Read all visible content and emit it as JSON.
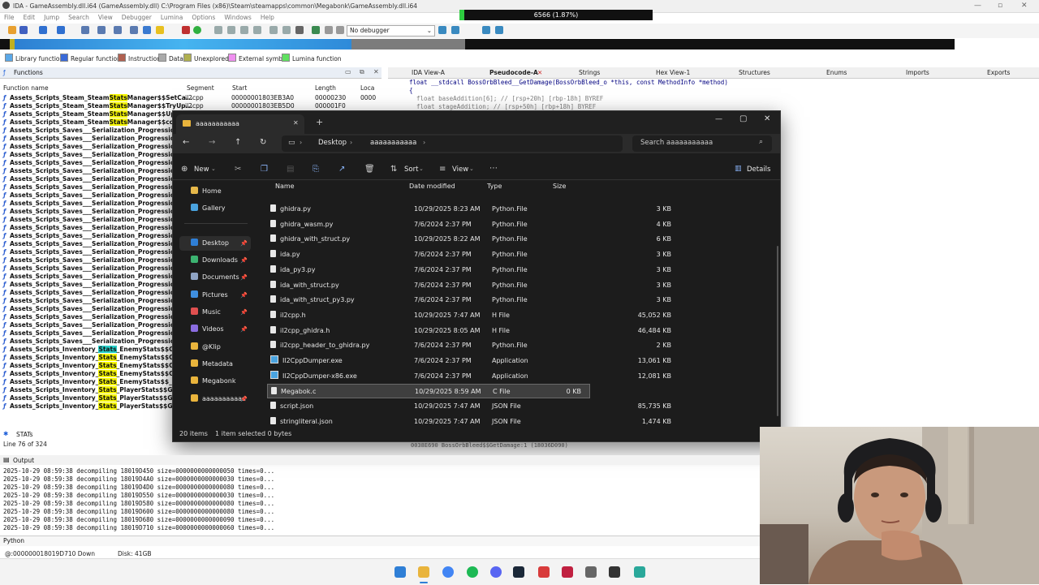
{
  "ida": {
    "title": "IDA - GameAssembly.dll.i64 (GameAssembly.dll) C:\\Program Files (x86)\\Steam\\steamapps\\common\\Megabonk\\GameAssembly.dll.i64",
    "progress_text": "6566 (1.87%)",
    "menu": [
      "File",
      "Edit",
      "Jump",
      "Search",
      "View",
      "Debugger",
      "Lumina",
      "Options",
      "Windows",
      "Help"
    ],
    "debugger_select": "No debugger",
    "legend": [
      "Library function",
      "Regular function",
      "Instruction",
      "Data",
      "Unexplored",
      "External symbol",
      "Lumina function"
    ],
    "functions_title": "Functions",
    "function_columns": [
      "Function name",
      "Segment",
      "Start",
      "Length",
      "Loca"
    ],
    "function_rows_top": [
      {
        "pre": "Assets_Scripts_Steam_Steam",
        "hl": "Stats",
        "post": "Manager$$SetCa...",
        "seg": "il2cpp",
        "start": "00000001803EB3A0",
        "len": "00000230",
        "loc": "0000"
      },
      {
        "pre": "Assets_Scripts_Steam_Steam",
        "hl": "Stats",
        "post": "Manager$$TryUp...",
        "seg": "il2cpp",
        "start": "00000001803EB5D0",
        "len": "000001F0",
        "loc": ""
      },
      {
        "pre": "Assets_Scripts_Steam_Steam",
        "hl": "Stats",
        "post": "Manager$$Upd",
        "seg": "",
        "start": "",
        "len": "",
        "loc": ""
      },
      {
        "pre": "Assets_Scripts_Steam_Steam",
        "hl": "Stats",
        "post": "Manager$$cct",
        "seg": "",
        "start": "",
        "len": "",
        "loc": ""
      }
    ],
    "progression_row": "Assets_Scripts_Saves___Serialization_Progression",
    "progression_count": 27,
    "inventory_rows": [
      {
        "pre": "Assets_Scripts_Inventory_",
        "hl": "Stats",
        "post": "_EnemyStats$$Ge",
        "cyan": true
      },
      {
        "pre": "Assets_Scripts_Inventory_",
        "hl": "Stats",
        "post": "_EnemyStats$$Ge",
        "cyan": false
      },
      {
        "pre": "Assets_Scripts_Inventory_",
        "hl": "Stats",
        "post": "_EnemyStats$$Ge",
        "cyan": false
      },
      {
        "pre": "Assets_Scripts_Inventory_",
        "hl": "Stats",
        "post": "_EnemyStats$$Ge",
        "cyan": false
      },
      {
        "pre": "Assets_Scripts_Inventory_",
        "hl": "Stats",
        "post": "_EnemyStats$$_cc",
        "cyan": false
      },
      {
        "pre": "Assets_Scripts_Inventory_",
        "hl": "Stats",
        "post": "_PlayerStats$$Ge",
        "cyan": false
      },
      {
        "pre": "Assets_Scripts_Inventory_",
        "hl": "Stats",
        "post": "_PlayerStats$$Ge",
        "cyan": false
      },
      {
        "pre": "Assets_Scripts_Inventory_",
        "hl": "Stats",
        "post": "_PlayerStats$$Ge",
        "cyan": false
      }
    ],
    "ps_tabs": [
      "IDA View-A",
      "Pseudocode-A",
      "Strings",
      "Hex View-1",
      "Structures",
      "Enums",
      "Imports",
      "Exports"
    ],
    "code_lines": [
      "float __stdcall BossOrbBleed__GetDamage(BossOrbBleed_o *this, const MethodInfo *method)",
      "{",
      "  float baseAddition[6]; // [rsp+20h] [rbp-18h] BYREF",
      "  float stageAddition; // [rsp+50h] [rbp+18h] BYREF"
    ],
    "code_status": "0038E690 BossOrbBleed$$GetDamage:1 (18036D090)",
    "stats_tab": "STATs",
    "line_info": "Line 76 of 324",
    "output_title": "Output",
    "output_lines": [
      "2025-10-29 08:59:38 decompiling 18019D450 size=0000000000000050 times=0...",
      "2025-10-29 08:59:38 decompiling 18019D4A0 size=0000000000000030 times=0...",
      "2025-10-29 08:59:38 decompiling 18019D4D0 size=0000000000000080 times=0...",
      "2025-10-29 08:59:38 decompiling 18019D550 size=0000000000000030 times=0...",
      "2025-10-29 08:59:38 decompiling 18019D580 size=0000000000000080 times=0...",
      "2025-10-29 08:59:38 decompiling 18019D600 size=0000000000000080 times=0...",
      "2025-10-29 08:59:38 decompiling 18019D680 size=0000000000000090 times=0...",
      "2025-10-29 08:59:38 decompiling 18019D710 size=0000000000000060 times=0..."
    ],
    "python_label": "Python",
    "status_left": "@:000000018019D710  Down",
    "status_disk": "Disk: 41GB"
  },
  "explorer": {
    "tab_title": "aaaaaaaaaaa",
    "breadcrumb": [
      "Desktop",
      "aaaaaaaaaaa"
    ],
    "search_placeholder": "Search aaaaaaaaaaa",
    "cmd": {
      "new": "New",
      "sort": "Sort",
      "view": "View",
      "details": "Details"
    },
    "nav": [
      {
        "label": "Home",
        "color": "#e6b84a"
      },
      {
        "label": "Gallery",
        "color": "#4aa3df"
      },
      {
        "label": "Desktop",
        "color": "#2f7fd6",
        "pinned": true,
        "selected": true
      },
      {
        "label": "Downloads",
        "color": "#3cb371",
        "pinned": true
      },
      {
        "label": "Documents",
        "color": "#8fa4c4",
        "pinned": true
      },
      {
        "label": "Pictures",
        "color": "#3f8fe0",
        "pinned": true
      },
      {
        "label": "Music",
        "color": "#e05050",
        "pinned": true
      },
      {
        "label": "Videos",
        "color": "#8b6de0",
        "pinned": true
      },
      {
        "label": "@Klip",
        "color": "#e9b43c"
      },
      {
        "label": "Metadata",
        "color": "#e9b43c"
      },
      {
        "label": "Megabonk",
        "color": "#e9b43c"
      },
      {
        "label": "aaaaaaaaaaa",
        "color": "#e9b43c",
        "pinned": true
      }
    ],
    "columns": [
      "Name",
      "Date modified",
      "Type",
      "Size"
    ],
    "files": [
      {
        "name": "ghidra.py",
        "date": "10/29/2025 8:23 AM",
        "type": "Python.File",
        "size": "3 KB"
      },
      {
        "name": "ghidra_wasm.py",
        "date": "7/6/2024 2:37 PM",
        "type": "Python.File",
        "size": "4 KB"
      },
      {
        "name": "ghidra_with_struct.py",
        "date": "10/29/2025 8:22 AM",
        "type": "Python.File",
        "size": "6 KB"
      },
      {
        "name": "ida.py",
        "date": "7/6/2024 2:37 PM",
        "type": "Python.File",
        "size": "3 KB"
      },
      {
        "name": "ida_py3.py",
        "date": "7/6/2024 2:37 PM",
        "type": "Python.File",
        "size": "3 KB"
      },
      {
        "name": "ida_with_struct.py",
        "date": "7/6/2024 2:37 PM",
        "type": "Python.File",
        "size": "3 KB"
      },
      {
        "name": "ida_with_struct_py3.py",
        "date": "7/6/2024 2:37 PM",
        "type": "Python.File",
        "size": "3 KB"
      },
      {
        "name": "il2cpp.h",
        "date": "10/29/2025 7:47 AM",
        "type": "H File",
        "size": "45,052 KB"
      },
      {
        "name": "il2cpp_ghidra.h",
        "date": "10/29/2025 8:05 AM",
        "type": "H File",
        "size": "46,484 KB"
      },
      {
        "name": "il2cpp_header_to_ghidra.py",
        "date": "7/6/2024 2:37 PM",
        "type": "Python.File",
        "size": "2 KB"
      },
      {
        "name": "Il2CppDumper.exe",
        "date": "7/6/2024 2:37 PM",
        "type": "Application",
        "size": "13,061 KB",
        "app": true
      },
      {
        "name": "Il2CppDumper-x86.exe",
        "date": "7/6/2024 2:37 PM",
        "type": "Application",
        "size": "12,081 KB",
        "app": true
      },
      {
        "name": "Megabok.c",
        "date": "10/29/2025 8:59 AM",
        "type": "C File",
        "size": "0 KB",
        "selected": true
      },
      {
        "name": "script.json",
        "date": "10/29/2025 7:47 AM",
        "type": "JSON File",
        "size": "85,735 KB"
      },
      {
        "name": "stringliteral.json",
        "date": "10/29/2025 7:47 AM",
        "type": "JSON File",
        "size": "1,474 KB"
      }
    ],
    "status_items": "20 items",
    "status_selected": "1 item selected  0 bytes"
  },
  "taskbar_icons": [
    "windows-start-icon",
    "file-explorer-icon",
    "chrome-icon",
    "spotify-icon",
    "discord-icon",
    "steam-icon",
    "app-red-icon",
    "app-stripes-icon",
    "settings-icon",
    "ida-icon",
    "app-teal-icon"
  ]
}
